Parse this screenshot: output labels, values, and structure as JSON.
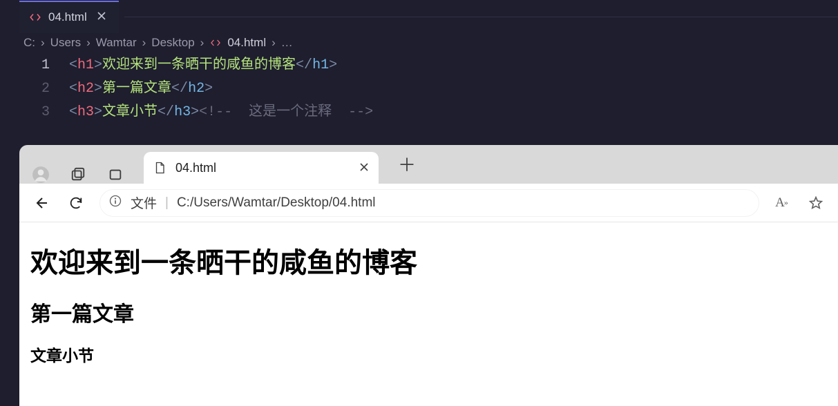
{
  "editor": {
    "tab": {
      "label": "04.html"
    },
    "breadcrumbs": {
      "parts": [
        "C:",
        "Users",
        "Wamtar",
        "Desktop"
      ],
      "file": "04.html",
      "tail": "…"
    },
    "lines": {
      "l1": {
        "num": "1",
        "tag": "h1",
        "text": "欢迎来到一条晒干的咸鱼的博客"
      },
      "l2": {
        "num": "2",
        "tag": "h2",
        "text": "第一篇文章"
      },
      "l3": {
        "num": "3",
        "tag": "h3",
        "text": "文章小节",
        "comment": "<!--  这是一个注释  -->"
      }
    }
  },
  "browser": {
    "tab": {
      "label": "04.html"
    },
    "address": {
      "scheme_label": "文件",
      "path": "C:/Users/Wamtar/Desktop/04.html"
    },
    "page": {
      "h1": "欢迎来到一条晒干的咸鱼的博客",
      "h2": "第一篇文章",
      "h3": "文章小节"
    }
  }
}
